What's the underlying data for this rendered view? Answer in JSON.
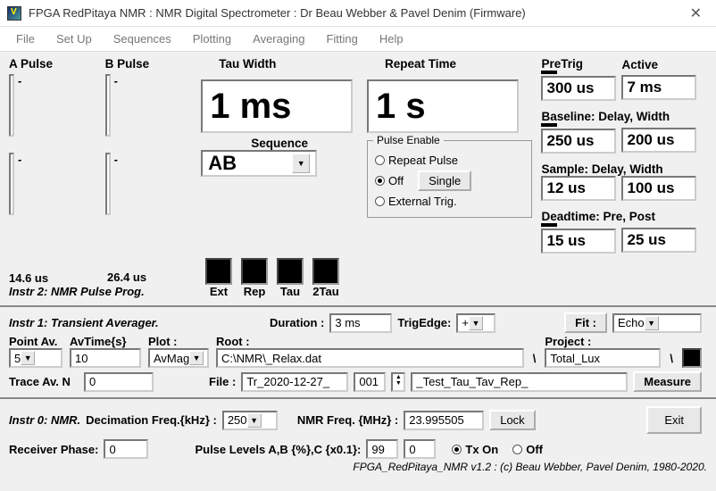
{
  "window": {
    "title": "FPGA RedPitaya NMR : NMR Digital Spectrometer : Dr Beau Webber & Pavel Denim (Firmware)"
  },
  "menu": [
    "File",
    "Set Up",
    "Sequences",
    "Plotting",
    "Averaging",
    "Fitting",
    "Help"
  ],
  "instr2": {
    "apulse_label": "A Pulse",
    "bpulse_label": "B Pulse",
    "a_val": "14.6 us",
    "b_val": "26.4 us",
    "instr_label": "Instr 2: NMR Pulse Prog.",
    "tau_label": "Tau Width",
    "tau_val": "1 ms",
    "seq_label": "Sequence",
    "seq_val": "AB",
    "repeat_label": "Repeat Time",
    "repeat_val": "1 s",
    "penable_label": "Pulse Enable",
    "opt_repeat": "Repeat Pulse",
    "opt_off": "Off",
    "opt_ext": "External Trig.",
    "single_btn": "Single",
    "sw_ext": "Ext",
    "sw_rep": "Rep",
    "sw_tau": "Tau",
    "sw_2tau": "2Tau",
    "pretrig_label": "PreTrig",
    "pretrig_val": "300 us",
    "active_label": "Active",
    "active_val": "7 ms",
    "baseline_label": "Baseline: Delay, Width",
    "baseline_d": "250 us",
    "baseline_w": "200 us",
    "sample_label": "Sample: Delay, Width",
    "sample_d": "12 us",
    "sample_w": "100 us",
    "deadtime_label": "Deadtime: Pre, Post",
    "dead_pre": "15 us",
    "dead_post": "25 us"
  },
  "instr1": {
    "label": "Instr 1: Transient Averager.",
    "duration_label": "Duration :",
    "duration_val": "3 ms",
    "trigedge_label": "TrigEdge:",
    "trigedge_val": "+",
    "fit_label": "Fit :",
    "fit_val": "Echo",
    "pointav_label": "Point Av.",
    "pointav_val": "5",
    "avtime_label": "AvTime{s}",
    "avtime_val": "10",
    "plot_label": "Plot :",
    "plot_val": "AvMag",
    "root_label": "Root :",
    "root_val": "C:\\NMR\\_Relax.dat",
    "project_label": "Project :",
    "project_val": "Total_Lux",
    "traceav_label": "Trace Av. N",
    "traceav_val": "0",
    "file_label": "File :",
    "file_prefix": "Tr_2020-12-27_",
    "file_num": "001",
    "file_suffix": "_Test_Tau_Tav_Rep_",
    "measure_btn": "Measure"
  },
  "instr0": {
    "label": "Instr 0: NMR.",
    "decim_label": "Decimation Freq.{kHz} :",
    "decim_val": "250",
    "nmrfreq_label": "NMR Freq. {MHz} :",
    "nmrfreq_val": "23.995505",
    "lock_btn": "Lock",
    "exit_btn": "Exit",
    "rxphase_label": "Receiver Phase:",
    "rxphase_val": "0",
    "levels_label": "Pulse Levels A,B {%},C {x0.1}:",
    "lvl_a": "99",
    "lvl_b": "0",
    "txon": "Tx On",
    "txoff": "Off",
    "footer": "FPGA_RedPitaya_NMR v1.2 : (c) Beau Webber, Pavel Denim, 1980-2020."
  }
}
